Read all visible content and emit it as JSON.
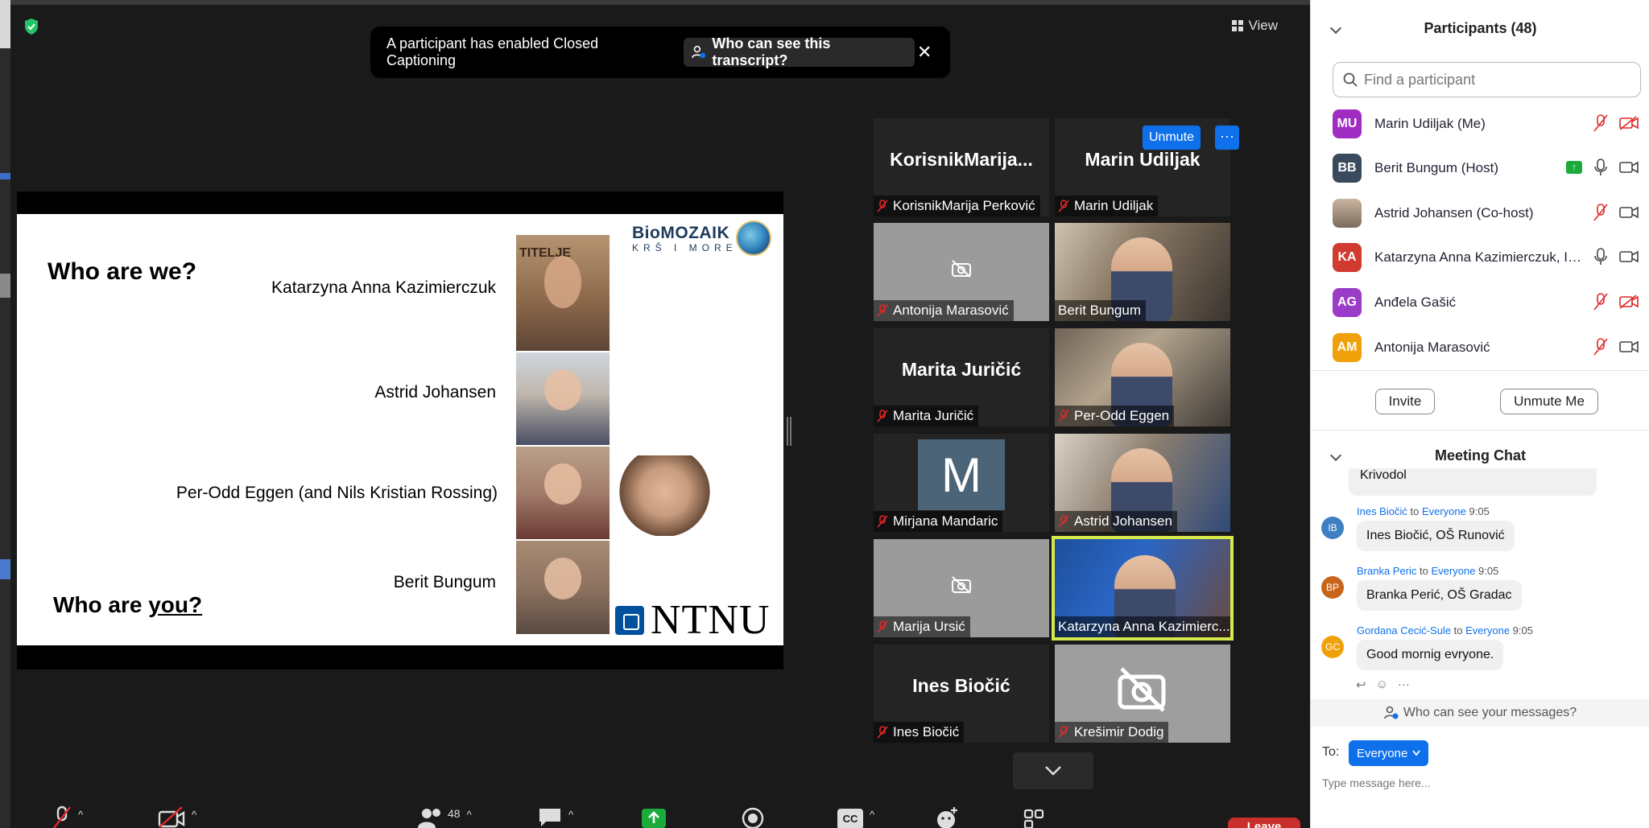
{
  "meeting": {
    "view_label": "View",
    "caption_banner": {
      "message": "A participant has enabled Closed Captioning",
      "who_label": "Who can see this transcript?"
    }
  },
  "slide": {
    "title": "Who are we?",
    "subtitle_prefix": "Who are ",
    "subtitle_emph": "you?",
    "names": [
      "Katarzyna Anna Kazimierczuk",
      "Astrid Johansen",
      "Per-Odd Eggen (and Nils Kristian Rossing)",
      "Berit Bungum"
    ],
    "photo_caption": "TITELJE",
    "logo_main": "BioMOZAIK",
    "logo_sub": "KRŠ I MORE",
    "ntnu": "NTNU"
  },
  "gallery": {
    "unmute_label": "Unmute",
    "more_label": "···",
    "tiles": [
      {
        "big": "KorisnikMarija...",
        "name": "KorisnikMarija Perković"
      },
      {
        "big": "Marin Udiljak",
        "name": "Marin Udiljak"
      },
      {
        "big": "",
        "name": "Antonija Marasović"
      },
      {
        "big": "",
        "name": "Berit Bungum"
      },
      {
        "big": "Marita Juričić",
        "name": "Marita Juričić"
      },
      {
        "big": "",
        "name": "Per-Odd Eggen"
      },
      {
        "big": "M",
        "name": "Mirjana Mandaric"
      },
      {
        "big": "",
        "name": "Astrid Johansen"
      },
      {
        "big": "",
        "name": "Marija Ursić"
      },
      {
        "big": "",
        "name": "Katarzyna Anna Kazimierc..."
      },
      {
        "big": "Ines Biočić",
        "name": "Ines Biočić"
      },
      {
        "big": "",
        "name": "Krešimir Dodig"
      }
    ]
  },
  "toolbar": {
    "participant_count": "48",
    "leave_label": "Leave",
    "cc_label": "CC"
  },
  "participants": {
    "header": "Participants (48)",
    "search_placeholder": "Find a participant",
    "list": [
      {
        "initials": "MU",
        "name": "Marin Udiljak (Me)",
        "color": "#a12cc2"
      },
      {
        "initials": "BB",
        "name": "Berit Bungum (Host)",
        "color": "#3a4a5e"
      },
      {
        "initials": "",
        "name": "Astrid Johansen (Co-host)",
        "color": "#b9a490"
      },
      {
        "initials": "KA",
        "name": "Katarzyna Anna Kazimierczuk, ID...",
        "color": "#d03a2f"
      },
      {
        "initials": "AG",
        "name": "Anđela Gašić",
        "color": "#9b3cc9"
      },
      {
        "initials": "AM",
        "name": "Antonija Marasović",
        "color": "#f0a10a"
      }
    ],
    "invite_label": "Invite",
    "unmute_me_label": "Unmute Me"
  },
  "chat": {
    "header": "Meeting Chat",
    "partial_text": "Krivodol",
    "messages": [
      {
        "initials": "IB",
        "from": "Ines Biočić",
        "to_word": " to ",
        "to": "Everyone",
        "time": "9:05",
        "text": "Ines Biočić, OŠ Runović",
        "color": "#3d7fc1"
      },
      {
        "initials": "BP",
        "from": "Branka Peric",
        "to_word": " to ",
        "to": "Everyone",
        "time": "9:05",
        "text": "Branka Perić, OŠ Gradac",
        "color": "#c8651b"
      },
      {
        "initials": "GC",
        "from": "Gordana Cecić-Sule",
        "to_word": " to ",
        "to": "Everyone",
        "time": "9:05",
        "text": "Good mornig evryone.",
        "color": "#f0a10a"
      }
    ],
    "who_can_see": "Who can see your messages?",
    "to_label": "To:",
    "to_value": "Everyone",
    "input_placeholder": "Type message here..."
  },
  "colors": {
    "accent": "#0e71eb",
    "leave": "#c9302c",
    "active_speaker": "#d6e94a",
    "mute_red": "#e02828"
  }
}
